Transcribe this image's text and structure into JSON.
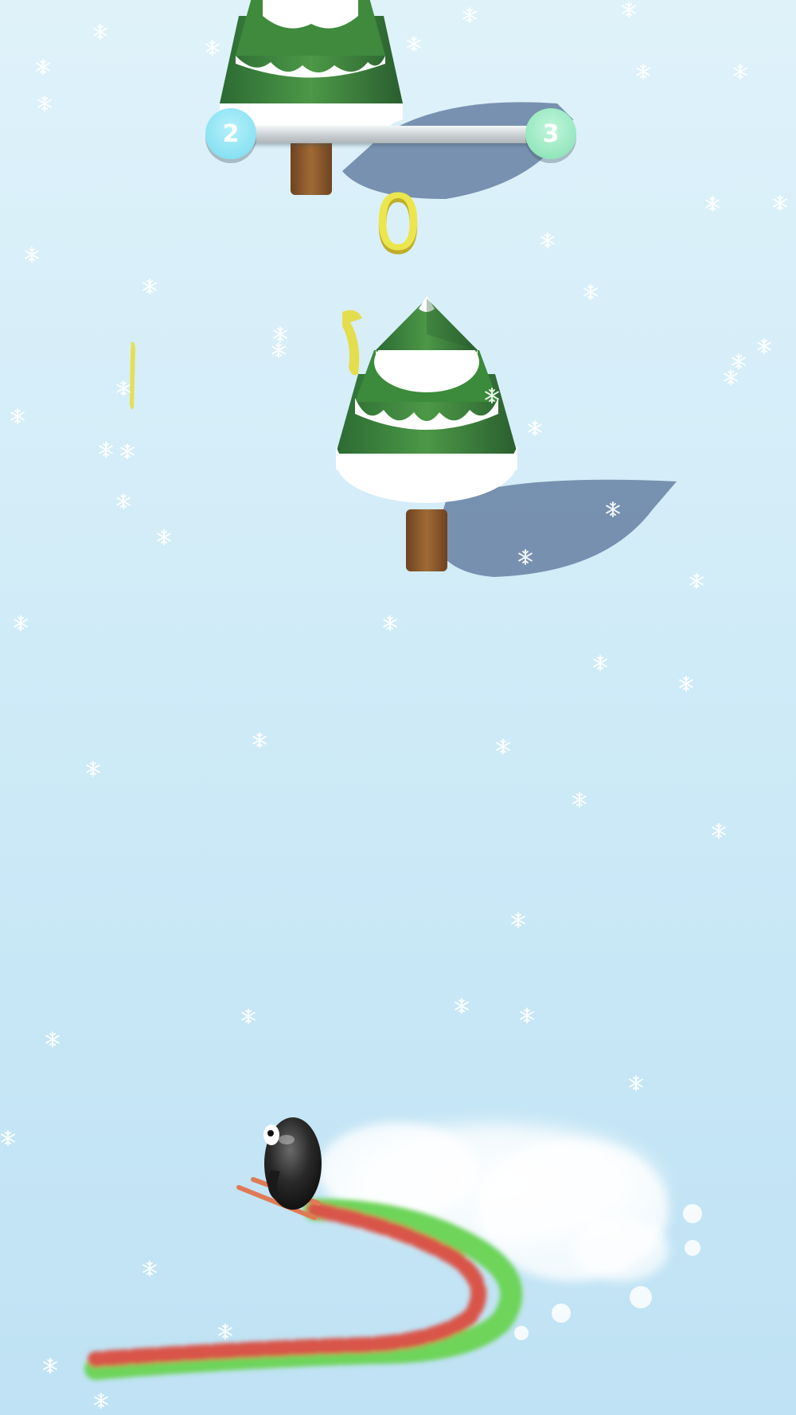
{
  "hud": {
    "level_current": "2",
    "level_next": "3",
    "level_progress": 0.08,
    "score": "0"
  },
  "colors": {
    "sky_snow": "#d2ecf8",
    "tree_dark": "#2f6b35",
    "tree_light": "#4f9c4a",
    "trunk": "#8b5a2b",
    "shadow": "#6b86a8",
    "trail_red": "#d9544a",
    "trail_green": "#6ed45a",
    "score_yellow": "#ece64c",
    "level_current_badge": "#8ae2f3",
    "level_next_badge": "#95e7be"
  },
  "icons": [
    "snowflake-icon",
    "penguin-player",
    "pine-tree"
  ]
}
